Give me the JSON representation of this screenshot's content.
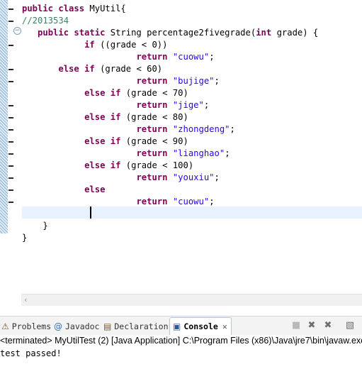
{
  "editor": {
    "lines": [
      {
        "indent": "",
        "parts": [
          {
            "t": "public class ",
            "c": "kw"
          },
          {
            "t": "MyUtil{",
            "c": ""
          }
        ]
      },
      {
        "indent": "",
        "parts": [
          {
            "t": "//2013534",
            "c": "cmt"
          }
        ]
      },
      {
        "indent": "   ",
        "parts": [
          {
            "t": "public static ",
            "c": "kw"
          },
          {
            "t": "String percentage2fivegrade(",
            "c": ""
          },
          {
            "t": "int ",
            "c": "kw"
          },
          {
            "t": "grade) {",
            "c": ""
          }
        ]
      },
      {
        "indent": "            ",
        "parts": [
          {
            "t": "if ",
            "c": "kw"
          },
          {
            "t": "((grade < 0))",
            "c": ""
          }
        ]
      },
      {
        "indent": "                      ",
        "parts": [
          {
            "t": "return ",
            "c": "kw"
          },
          {
            "t": "\"cuowu\"",
            "c": "str"
          },
          {
            "t": ";",
            "c": ""
          }
        ]
      },
      {
        "indent": "       ",
        "parts": [
          {
            "t": "else if ",
            "c": "kw"
          },
          {
            "t": "(grade < 60)",
            "c": ""
          }
        ]
      },
      {
        "indent": "                      ",
        "parts": [
          {
            "t": "return ",
            "c": "kw"
          },
          {
            "t": "\"bujige\"",
            "c": "str"
          },
          {
            "t": ";",
            "c": ""
          }
        ]
      },
      {
        "indent": "            ",
        "parts": [
          {
            "t": "else if ",
            "c": "kw"
          },
          {
            "t": "(grade < 70)",
            "c": ""
          }
        ]
      },
      {
        "indent": "                      ",
        "parts": [
          {
            "t": "return ",
            "c": "kw"
          },
          {
            "t": "\"jige\"",
            "c": "str"
          },
          {
            "t": ";",
            "c": ""
          }
        ]
      },
      {
        "indent": "            ",
        "parts": [
          {
            "t": "else if ",
            "c": "kw"
          },
          {
            "t": "(grade < 80)",
            "c": ""
          }
        ]
      },
      {
        "indent": "                      ",
        "parts": [
          {
            "t": "return ",
            "c": "kw"
          },
          {
            "t": "\"zhongdeng\"",
            "c": "str"
          },
          {
            "t": ";",
            "c": ""
          }
        ]
      },
      {
        "indent": "            ",
        "parts": [
          {
            "t": "else if ",
            "c": "kw"
          },
          {
            "t": "(grade < 90)",
            "c": ""
          }
        ]
      },
      {
        "indent": "                      ",
        "parts": [
          {
            "t": "return ",
            "c": "kw"
          },
          {
            "t": "\"lianghao\"",
            "c": "str"
          },
          {
            "t": ";",
            "c": ""
          }
        ]
      },
      {
        "indent": "            ",
        "parts": [
          {
            "t": "else if ",
            "c": "kw"
          },
          {
            "t": "(grade < 100)",
            "c": ""
          }
        ]
      },
      {
        "indent": "                      ",
        "parts": [
          {
            "t": "return ",
            "c": "kw"
          },
          {
            "t": "\"youxiu\"",
            "c": "str"
          },
          {
            "t": ";",
            "c": ""
          }
        ]
      },
      {
        "indent": "            ",
        "parts": [
          {
            "t": "else",
            "c": "kw"
          }
        ]
      },
      {
        "indent": "                      ",
        "parts": [
          {
            "t": "return ",
            "c": "kw"
          },
          {
            "t": "\"cuowu\"",
            "c": "str"
          },
          {
            "t": ";",
            "c": ""
          }
        ]
      },
      {
        "indent": "",
        "parts": []
      },
      {
        "indent": "    ",
        "parts": [
          {
            "t": "}",
            "c": ""
          }
        ]
      },
      {
        "indent": "",
        "parts": [
          {
            "t": "}",
            "c": ""
          }
        ]
      }
    ],
    "fold_icon": "collapse-icon"
  },
  "tabs": [
    {
      "name": "tab-problems",
      "icon": "problems-icon",
      "glyph": "⚠",
      "label": "Problems"
    },
    {
      "name": "tab-javadoc",
      "icon": "javadoc-icon",
      "glyph": "@",
      "label": "Javadoc"
    },
    {
      "name": "tab-declaration",
      "icon": "declaration-icon",
      "glyph": "▤",
      "label": "Declaration"
    },
    {
      "name": "tab-console",
      "icon": "console-icon",
      "glyph": "▣",
      "label": "Console",
      "close": "✕"
    }
  ],
  "toolbar_icons": [
    "terminate-icon",
    "remove-launch-icon",
    "remove-all-terminated-icon",
    "clear-console-icon"
  ],
  "console": {
    "header": "<terminated> MyUtilTest (2) [Java Application] C:\\Program Files (x86)\\Java\\jre7\\bin\\javaw.exe",
    "output": "test passed!"
  },
  "colors": {
    "keyword": "#7f0055",
    "string": "#2a00ff",
    "comment": "#3f7f5f",
    "current_line": "#e8f2fe"
  }
}
